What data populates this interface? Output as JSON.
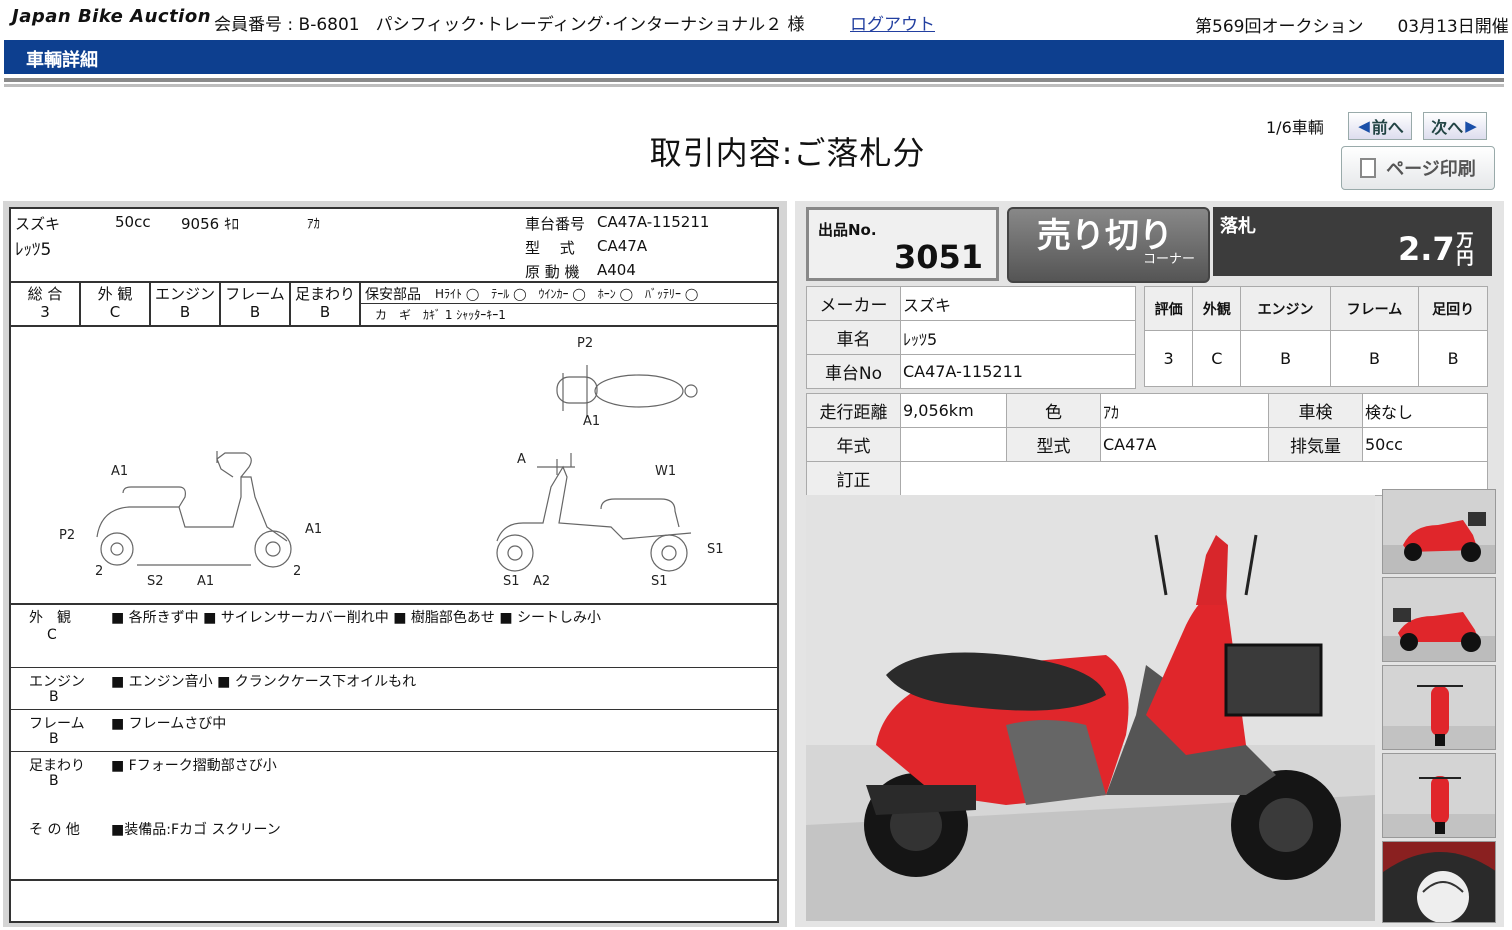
{
  "header": {
    "logo": "Japan Bike Auction",
    "member_label": "会員番号 : B-6801",
    "member_name": "パシフィック･トレーディング･インターナショナル２ 様",
    "logout": "ログアウト",
    "auction_no": "第569回オークション",
    "auction_date": "03月13日開催"
  },
  "section_title": "車輌詳細",
  "page_title": "取引内容:ご落札分",
  "nav": {
    "counter": "1/6車輌",
    "prev": "前へ",
    "next": "次へ",
    "print": "ページ印刷"
  },
  "sheet": {
    "maker": "スズキ",
    "cc": "50cc",
    "km": "9056 ｷﾛ",
    "color": "ｱｶ",
    "model": "ﾚｯﾂ5",
    "frame_label": "車台番号",
    "frame_no": "CA47A-115211",
    "type_label": "型　 式",
    "type": "CA47A",
    "engine_label": "原 動 機",
    "engine": "A404",
    "grade_heads": [
      "総 合",
      "外 観",
      "エンジン",
      "フレーム",
      "足まわり"
    ],
    "grade_vals": [
      "3",
      "C",
      "B",
      "B",
      "B"
    ],
    "parts_label": "保安部品",
    "parts": "Hﾗｲﾄ ◯　ﾃｰﾙ ◯　ｳｲﾝｶｰ ◯　ﾎｰﾝ ◯　ﾊﾞｯﾃﾘｰ ◯",
    "keys": "カ　ギ　ｶｷﾞ 1 ｼｬｯﾀｰｷｰ1",
    "diagram_labels": {
      "p2_top": "P2",
      "a1_top": "A1",
      "a1_left": "A1",
      "p2_left": "P2",
      "a1_right": "A1",
      "two_a": "2",
      "s2": "S2",
      "a1_bottom": "A1",
      "two_b": "2",
      "a_rear": "A",
      "w1": "W1",
      "s1_right": "S1",
      "s1_a": "S1",
      "a2": "A2",
      "s1_b": "S1"
    },
    "remarks": [
      {
        "head": "外　観",
        "grade": "C",
        "text": "■ 各所きず中 ■ サイレンサーカバー削れ中 ■ 樹脂部色あせ ■ シートしみ小"
      },
      {
        "head": "エンジン",
        "grade": "B",
        "text": "■ エンジン音小 ■ クランクケース下オイルもれ"
      },
      {
        "head": "フレーム",
        "grade": "B",
        "text": "■ フレームさび中"
      },
      {
        "head": "足まわり",
        "grade": "B",
        "text": "■ Fフォーク摺動部さび小"
      },
      {
        "head": "そ の 他",
        "grade": "",
        "text": "■装備品:Fカゴ スクリーン"
      }
    ]
  },
  "lot": {
    "label": "出品No.",
    "number": "3051"
  },
  "corner": {
    "big": "売り切り",
    "small": "コーナー"
  },
  "price": {
    "label": "落札",
    "value": "2.7",
    "unit_top": "万",
    "unit_bottom": "円"
  },
  "info": {
    "maker_label": "メーカー",
    "maker": "スズキ",
    "name_label": "車名",
    "name": "ﾚｯﾂ5",
    "frame_label": "車台No",
    "frame": "CA47A-115211",
    "grade_heads": [
      "評価",
      "外観",
      "エンジン",
      "フレーム",
      "足回り"
    ],
    "grade_vals": [
      "3",
      "C",
      "B",
      "B",
      "B"
    ],
    "mileage_label": "走行距離",
    "mileage": "9,056km",
    "color_label": "色",
    "color": "ｱｶ",
    "inspection_label": "車検",
    "inspection": "検なし",
    "year_label": "年式",
    "year": "",
    "model_label": "型式",
    "model": "CA47A",
    "cc_label": "排気量",
    "cc": "50cc",
    "correction_label": "訂正",
    "correction": ""
  },
  "colors": {
    "band": "#0d3f8f",
    "bike_red": "#e0262b"
  }
}
